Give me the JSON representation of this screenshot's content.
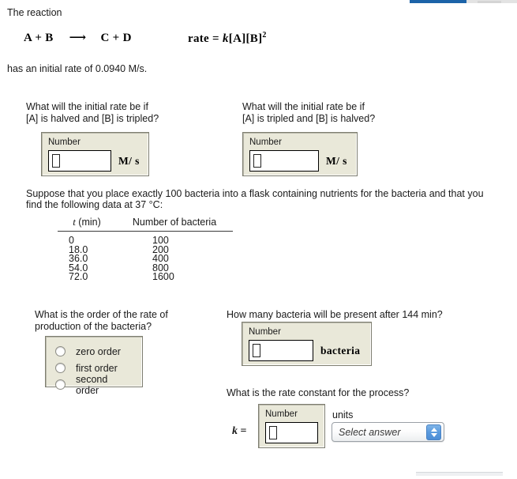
{
  "intro": {
    "lead": "The reaction",
    "equation_left": "A + B",
    "equation_arrow": "⟶",
    "equation_right": "C + D",
    "rate_law_prefix": "rate = ",
    "rate_law_k": "k",
    "rate_law_a": "[A]",
    "rate_law_b": "[B]",
    "rate_law_exponent": "2",
    "initial_rate_sentence": "has an initial rate of 0.0940 M/s."
  },
  "question1": {
    "prompt": "What will the initial rate be if\n[A] is halved and [B] is tripled?",
    "panel_label": "Number",
    "input_value": "",
    "unit": "M/ s"
  },
  "question2": {
    "prompt": "What will the initial rate be if\n[A] is tripled and [B] is halved?",
    "panel_label": "Number",
    "input_value": "",
    "unit": "M/ s"
  },
  "bacteria_intro": "Suppose that you place exactly 100 bacteria into a flask containing nutrients for the bacteria and that you find the following data at 37 °C:",
  "chart_data": {
    "type": "table",
    "title": "",
    "columns": [
      "t (min)",
      "Number of bacteria"
    ],
    "x": [
      0,
      18.0,
      36.0,
      54.0,
      72.0
    ],
    "values": [
      100,
      200,
      400,
      800,
      1600
    ],
    "xlabel": "t (min)",
    "ylabel": "Number of bacteria",
    "rows": [
      {
        "t": "0",
        "n": "100"
      },
      {
        "t": "18.0",
        "n": "200"
      },
      {
        "t": "36.0",
        "n": "400"
      },
      {
        "t": "54.0",
        "n": "800"
      },
      {
        "t": "72.0",
        "n": "1600"
      }
    ],
    "header_t_var": "t",
    "header_t_unit": " (min)",
    "header_n": "Number of bacteria"
  },
  "question3": {
    "prompt": "What is the order of the rate of\nproduction of the bacteria?",
    "options": [
      {
        "label": "zero order",
        "selected": false
      },
      {
        "label": "first order",
        "selected": false
      },
      {
        "label": "second order",
        "selected": false
      }
    ]
  },
  "question4": {
    "prompt": "How many bacteria will be present after 144 min?",
    "panel_label": "Number",
    "input_value": "",
    "unit": "bacteria"
  },
  "question5": {
    "prompt": "What is the rate constant for the process?",
    "k_symbol": "k",
    "k_equals": " =",
    "panel_label": "Number",
    "input_value": "",
    "units_caption": "units",
    "select_value": "Select answer"
  },
  "colors": {
    "panel_bg": "#e9e8d9",
    "panel_border": "#7e7e70",
    "accent_blue": "#5a9ade",
    "text": "#1a1a1a"
  }
}
